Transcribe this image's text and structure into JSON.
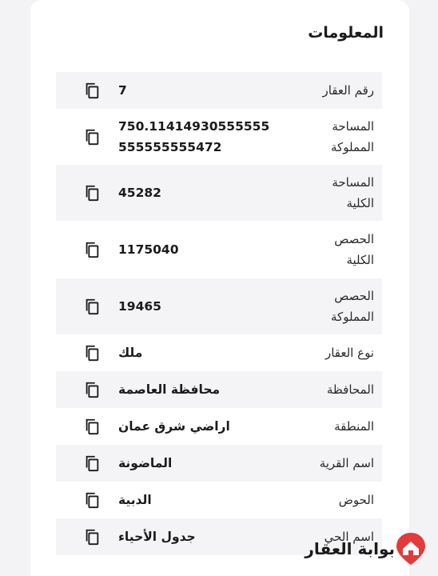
{
  "section": {
    "title": "المعلومات"
  },
  "rows": [
    {
      "label": "رقم العقار",
      "value": "7"
    },
    {
      "label": "المساحة المملوكة",
      "value": "750.11414930555555555555555472"
    },
    {
      "label": "المساحة الكلية",
      "value": "45282"
    },
    {
      "label": "الحصص الكلية",
      "value": "1175040"
    },
    {
      "label": "الحصص المملوكة",
      "value": "19465"
    },
    {
      "label": "نوع العقار",
      "value": "ملك"
    },
    {
      "label": "المحافظة",
      "value": "محافظة العاصمة"
    },
    {
      "label": "المنطقة",
      "value": "اراضي شرق عمان"
    },
    {
      "label": "اسم القرية",
      "value": "الماضونة"
    },
    {
      "label": "الحوض",
      "value": "الدبية"
    },
    {
      "label": "اسم الحي",
      "value": "جدول الأحياء"
    }
  ],
  "icons": {
    "copy": "copy-icon"
  },
  "brand": {
    "name": "بوابة العقار",
    "color": "#e23b3b"
  }
}
